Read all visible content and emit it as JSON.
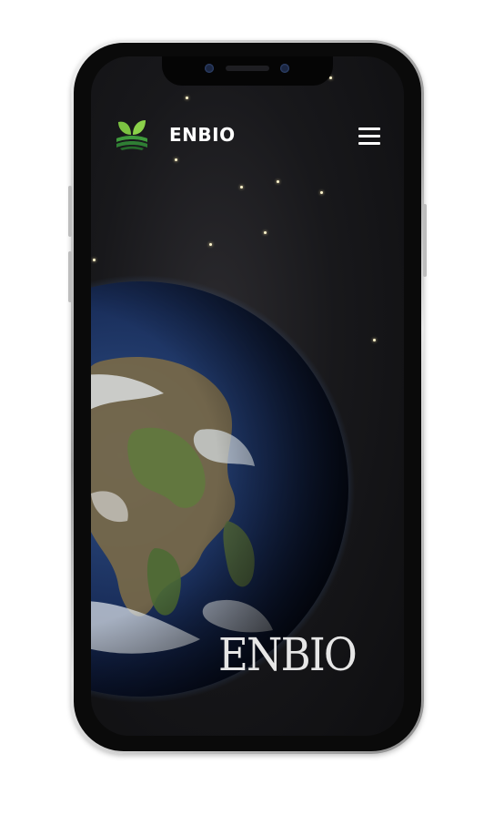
{
  "nav": {
    "brand": "ENBIO",
    "logo_icon": "leaf-logo-icon",
    "menu_icon": "hamburger-menu-icon"
  },
  "hero": {
    "title": "ENBIO",
    "background": "earth-from-space"
  },
  "colors": {
    "background": "#16161a",
    "text": "#ffffff",
    "logo_green": "#4caf50",
    "hero_text": "#e6e6e6"
  }
}
